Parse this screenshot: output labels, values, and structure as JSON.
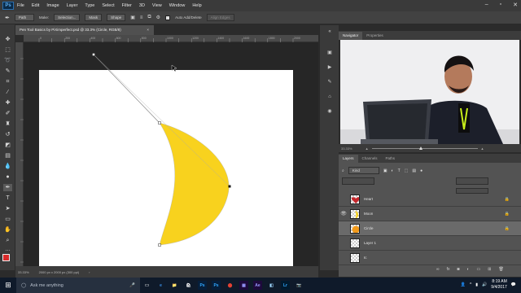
{
  "menubar": {
    "logo": "Ps",
    "items": [
      "File",
      "Edit",
      "Image",
      "Layer",
      "Type",
      "Select",
      "Filter",
      "3D",
      "View",
      "Window",
      "Help"
    ]
  },
  "options": {
    "mode": "Path",
    "make_label": "Make:",
    "selection_button": "Selection...",
    "mask_button": "Mask",
    "shape_button": "Shape",
    "auto_add_delete": "Auto Add/Delete",
    "align_edges": "Align Edges"
  },
  "document": {
    "tab_title": "Pen Tool Basics by PiXimperfect.psd @ 33.3% (Circle, RGB/8)",
    "zoom": "33.33%",
    "doc_info": "2000 px x 2000 px (300 ppi)",
    "ruler_ticks": [
      "0",
      "100",
      "200",
      "300",
      "400",
      "500",
      "600",
      "700",
      "800",
      "900",
      "1000",
      "1100",
      "1200",
      "1300",
      "1400",
      "1500",
      "1600",
      "1700",
      "1800",
      "1900",
      "2000"
    ]
  },
  "shape_color": "#f8d21e",
  "navigator": {
    "tabs": [
      "Navigator",
      "Properties"
    ],
    "zoom": "33.33%"
  },
  "layers": {
    "tabs": [
      "Layers",
      "Channels",
      "Paths"
    ],
    "kind_label": "Kind",
    "rows": [
      {
        "name": "Heart",
        "visible": false,
        "thumb": "heart",
        "locked": true
      },
      {
        "name": "Moon",
        "visible": true,
        "thumb": "moon",
        "locked": true
      },
      {
        "name": "Circle",
        "visible": false,
        "thumb": "circle",
        "locked": true,
        "selected": true
      },
      {
        "name": "Layer 1",
        "visible": false,
        "thumb": "blank",
        "locked": false
      },
      {
        "name": "Ic",
        "visible": false,
        "thumb": "blank",
        "locked": false
      }
    ]
  },
  "taskbar": {
    "search_placeholder": "Ask me anything",
    "apps": [
      "e",
      "📁",
      "🛍",
      "Ps",
      "Ps",
      "⬤",
      "▦",
      "Ae",
      "◧",
      "Lr",
      "📷"
    ],
    "time": "8:19 AM",
    "date": "9/4/2017"
  }
}
